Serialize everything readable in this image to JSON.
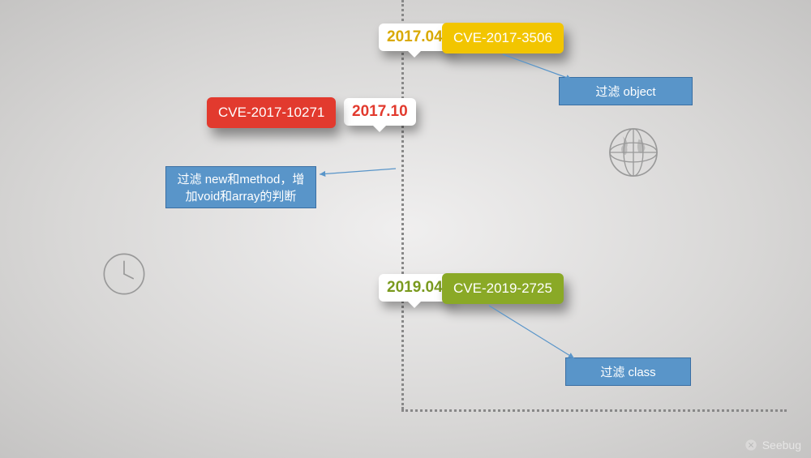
{
  "timeline": [
    {
      "date": "2017.04",
      "date_color": "#d9a900",
      "cve": "CVE-2017-3506",
      "cve_bg": "#f2c500",
      "note": "过滤 object"
    },
    {
      "date": "2017.10",
      "date_color": "#e23a2e",
      "cve": "CVE-2017-10271",
      "cve_bg": "#e23a2e",
      "note_lines": [
        "过滤 new和method，增",
        "加void和array的判断"
      ]
    },
    {
      "date": "2019.04",
      "date_color": "#7a9a1e",
      "cve": "CVE-2019-2725",
      "cve_bg": "#8aa926",
      "note": "过滤 class"
    }
  ],
  "brand": "Seebug"
}
